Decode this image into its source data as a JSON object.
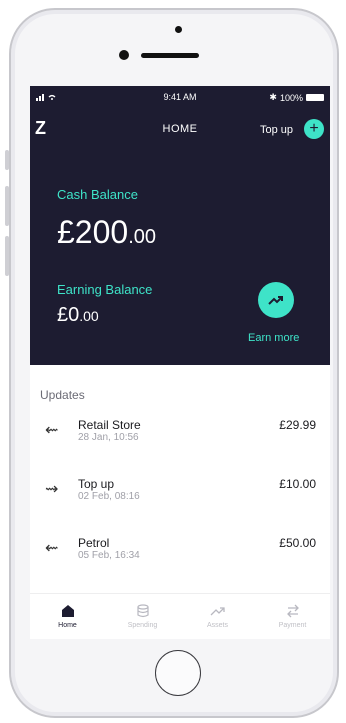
{
  "status_bar": {
    "time": "9:41 AM",
    "battery": "100%"
  },
  "header": {
    "logo": "Z",
    "title": "HOME",
    "topup_label": "Top up",
    "topup_icon": "+"
  },
  "balances": {
    "cash_label": "Cash Balance",
    "cash_whole": "£200",
    "cash_decimal": ".00",
    "earning_label": "Earning Balance",
    "earning_whole": "£0",
    "earning_decimal": ".00",
    "earn_more_label": "Earn more"
  },
  "updates": {
    "title": "Updates",
    "items": [
      {
        "name": "Retail Store",
        "date": "28 Jan, 10:56",
        "amount": "£29.99",
        "direction": "out"
      },
      {
        "name": "Top up",
        "date": "02 Feb, 08:16",
        "amount": "£10.00",
        "direction": "in"
      },
      {
        "name": "Petrol",
        "date": "05 Feb, 16:34",
        "amount": "£50.00",
        "direction": "out"
      }
    ]
  },
  "tabs": [
    {
      "label": "Home",
      "icon": "home-icon",
      "active": true
    },
    {
      "label": "Spending",
      "icon": "coins-icon",
      "active": false
    },
    {
      "label": "Assets",
      "icon": "trend-icon",
      "active": false
    },
    {
      "label": "Payment",
      "icon": "transfer-icon",
      "active": false
    }
  ],
  "colors": {
    "accent": "#3ee3c8",
    "dark_bg": "#1d1c31"
  }
}
